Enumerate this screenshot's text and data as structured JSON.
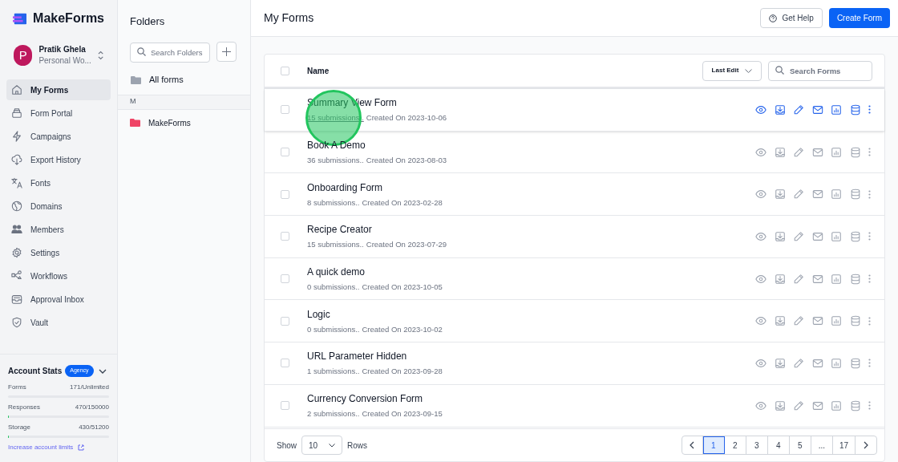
{
  "brand": {
    "name": "MakeForms"
  },
  "user": {
    "initial": "P",
    "name": "Pratik Ghela",
    "workspace": "Personal Wo..."
  },
  "nav": [
    {
      "label": "My Forms",
      "selected": true
    },
    {
      "label": "Form Portal",
      "selected": false
    },
    {
      "label": "Campaigns",
      "selected": false
    },
    {
      "label": "Export History",
      "selected": false
    },
    {
      "label": "Fonts",
      "selected": false
    },
    {
      "label": "Domains",
      "selected": false
    },
    {
      "label": "Members",
      "selected": false
    },
    {
      "label": "Settings",
      "selected": false
    },
    {
      "label": "Workflows",
      "selected": false
    },
    {
      "label": "Approval Inbox",
      "selected": false
    },
    {
      "label": "Vault",
      "selected": false
    }
  ],
  "account_stats": {
    "title": "Account Stats",
    "badge": "Agency",
    "stats": [
      {
        "label": "Forms",
        "value": "171/Unlimited"
      },
      {
        "label": "Responses",
        "value": "470/150000",
        "level": 0.004
      },
      {
        "label": "Storage",
        "value": "430/51200",
        "level": 0.009
      }
    ],
    "link": "Increase account limits"
  },
  "folders": {
    "title": "Folders",
    "search_placeholder": "Search Folders",
    "all_label": "All forms",
    "group": "M",
    "items": [
      {
        "name": "MakeForms"
      }
    ]
  },
  "header": {
    "title": "My Forms",
    "help": "Get Help",
    "create": "Create Form"
  },
  "table": {
    "select_all_checked": false,
    "column": "Name",
    "sort": "Last Edit",
    "search_placeholder": "Search Forms",
    "rows": [
      {
        "name": "Summary View Form",
        "submissions": "15 submissions..",
        "created": "Created On 2023-10-06",
        "highlighted": true,
        "checked": false
      },
      {
        "name": "Book A Demo",
        "submissions": "36 submissions..",
        "created": "Created On 2023-08-03",
        "highlighted": false,
        "checked": false
      },
      {
        "name": "Onboarding Form",
        "submissions": "8 submissions..",
        "created": "Created On 2023-02-28",
        "highlighted": false,
        "checked": false
      },
      {
        "name": "Recipe Creator",
        "submissions": "15 submissions..",
        "created": "Created On 2023-07-29",
        "highlighted": false,
        "checked": false
      },
      {
        "name": "A quick demo",
        "submissions": "0 submissions..",
        "created": "Created On 2023-10-05",
        "highlighted": false,
        "checked": false
      },
      {
        "name": "Logic",
        "submissions": "0 submissions..",
        "created": "Created On 2023-10-02",
        "highlighted": false,
        "checked": false
      },
      {
        "name": "URL Parameter Hidden",
        "submissions": "1 submissions..",
        "created": "Created On 2023-09-28",
        "highlighted": false,
        "checked": false
      },
      {
        "name": "Currency Conversion Form",
        "submissions": "2 submissions..",
        "created": "Created On 2023-09-15",
        "highlighted": false,
        "checked": false
      }
    ]
  },
  "footer": {
    "show": "Show",
    "rows_value": "10",
    "rows": "Rows",
    "pages": [
      {
        "label": "1",
        "selected": true
      },
      {
        "label": "2",
        "selected": false
      },
      {
        "label": "3",
        "selected": false
      },
      {
        "label": "4",
        "selected": false
      },
      {
        "label": "5",
        "selected": false
      },
      {
        "label": "...",
        "selected": false
      },
      {
        "label": "17",
        "selected": false
      }
    ]
  }
}
